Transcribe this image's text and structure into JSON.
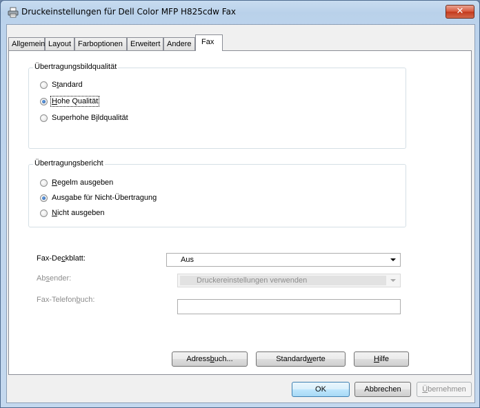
{
  "window": {
    "title": "Druckeinstellungen für Dell Color MFP H825cdw Fax",
    "close_label": "✕"
  },
  "tabs": [
    {
      "label": "Allgemein"
    },
    {
      "label": "Layout"
    },
    {
      "label": "Farboptionen"
    },
    {
      "label": "Erweitert"
    },
    {
      "label": "Andere"
    },
    {
      "label": "Fax",
      "active": true
    }
  ],
  "image_quality": {
    "legend": "Übertragungsbildqualität",
    "options": [
      {
        "pre": "S",
        "key": "t",
        "post": "andard",
        "checked": false
      },
      {
        "pre": "",
        "key": "H",
        "post": "ohe Qualität",
        "checked": true
      },
      {
        "pre": "Superhohe B",
        "key": "i",
        "post": "ldqualität",
        "checked": false
      }
    ]
  },
  "report": {
    "legend": "Übertragungsbericht",
    "options": [
      {
        "pre": "",
        "key": "R",
        "post": "egelm ausgeben",
        "checked": false
      },
      {
        "pre": "Aus",
        "key": "g",
        "post": "abe für Nicht-Übertragung",
        "checked": true
      },
      {
        "pre": "",
        "key": "N",
        "post": "icht ausgeben",
        "checked": false
      }
    ]
  },
  "fax_cover": {
    "label_pre": "Fax-De",
    "label_key": "c",
    "label_post": "kblatt:",
    "value": "Aus"
  },
  "sender": {
    "label_pre": "Ab",
    "label_key": "s",
    "label_post": "ender:",
    "value": "Druckereinstellungen verwenden"
  },
  "phonebook": {
    "label_pre": "Fax-Telefon",
    "label_key": "b",
    "label_post": "uch:",
    "value": ""
  },
  "panel_buttons": {
    "address_pre": "Adress",
    "address_key": "b",
    "address_post": "uch...",
    "defaults_pre": "Standard",
    "defaults_key": "w",
    "defaults_post": "erte",
    "help_pre": "",
    "help_key": "H",
    "help_post": "ilfe"
  },
  "dialog_buttons": {
    "ok": "OK",
    "cancel": "Abbrechen",
    "apply_pre": "",
    "apply_key": "Ü",
    "apply_post": "bernehmen"
  }
}
